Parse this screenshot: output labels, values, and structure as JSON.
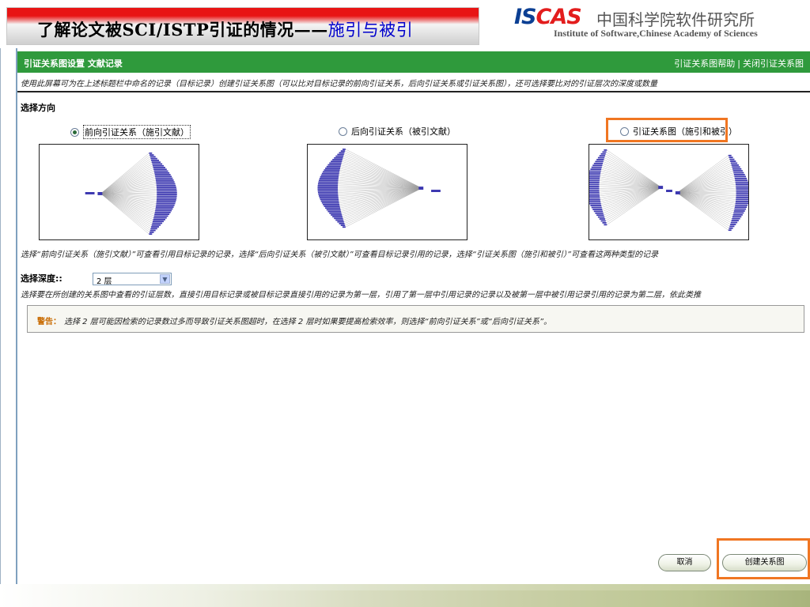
{
  "slide": {
    "title": "了解论文被SCI/ISTP引证的情况——",
    "title_suffix": "施引与被引"
  },
  "logo": {
    "mark_blue": "IS",
    "mark_red": "CAS",
    "cn": "中国科学院软件研究所",
    "en": "Institute of Software,Chinese Academy of Sciences"
  },
  "header": {
    "title": "引证关系图设置 文献记录",
    "help_link": "引证关系图帮助",
    "separator": "|",
    "close_link": "关闭引证关系图"
  },
  "instruction": "使用此屏幕可为在上述标题栏中命名的记录（目标记录）创建引证关系图（可以比对目标记录的前向引证关系，后向引证关系或引证关系图），还可选择要比对的引证层次的深度或数量",
  "direction": {
    "label": "选择方向",
    "options": [
      {
        "label": "前向引证关系（施引文献）",
        "selected": true
      },
      {
        "label": "后向引证关系（被引文献）",
        "selected": false
      },
      {
        "label": "引证关系图（施引和被引）",
        "selected": false
      }
    ]
  },
  "direction_note": "选择“前向引证关系（施引文献）”可查看引用目标记录的记录，选择“后向引证关系（被引文献）”可查看目标记录引用的记录，选择“引证关系图（施引和被引）”可查看这两种类型的记录",
  "depth": {
    "label": "选择深度::",
    "selected": "2 层",
    "note": "选择要在所创建的关系图中查看的引证层数，直接引用目标记录或被目标记录直接引用的记录为第一层，引用了第一层中引用记录的记录以及被第一层中被引用记录引用的记录为第二层，依此类推"
  },
  "warning": {
    "tag": "警告：",
    "text": "选择 2 层可能因检索的记录数过多而导致引证关系图超时，在选择 2 层时如果要提高检索效率，则选择“前向引证关系”或“后向引证关系”。"
  },
  "buttons": {
    "cancel": "取消",
    "create": "创建关系图"
  },
  "colors": {
    "header_green": "#2f9a3c",
    "highlight_orange": "#f07622",
    "graph_blue": "#3b37b0",
    "title_red": "#e81414"
  }
}
